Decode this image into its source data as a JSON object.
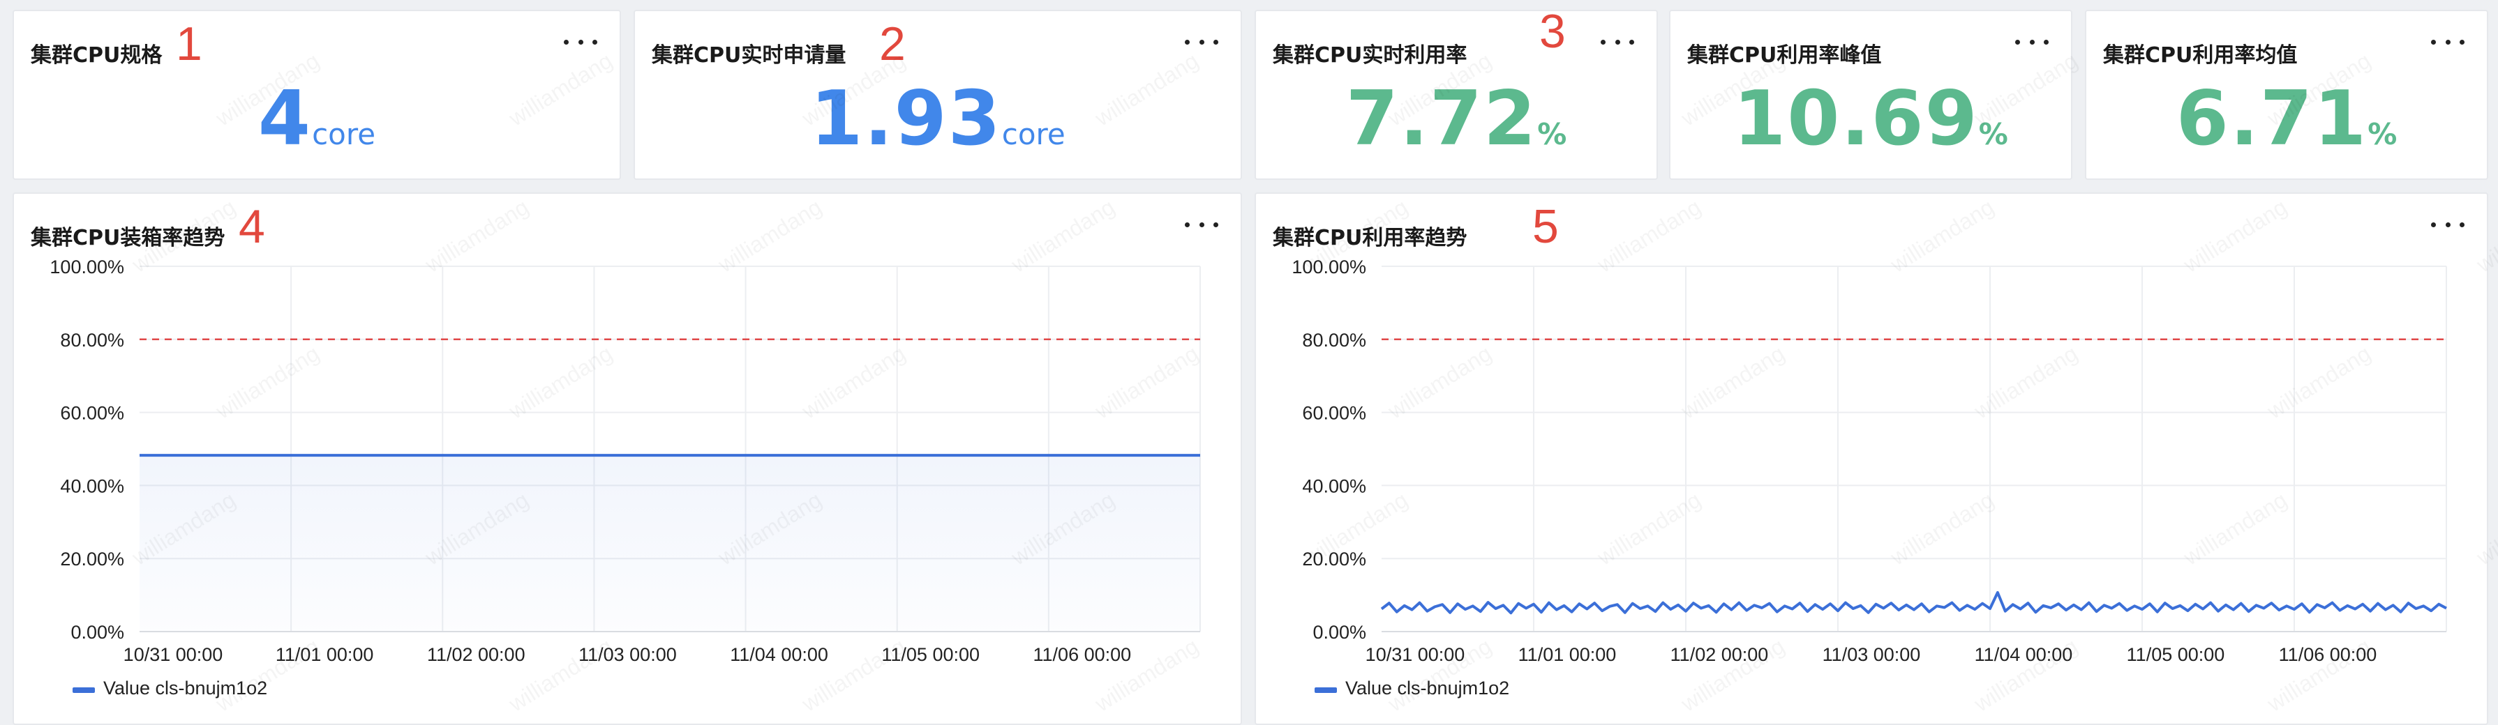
{
  "colors": {
    "blue_value": "#4187ea",
    "green_value": "#5cb98e",
    "marker_red": "#e2483d",
    "threshold_red": "#e04848",
    "series_blue": "#3b6fd8"
  },
  "cards": [
    {
      "title": "集群CPU规格",
      "value": "4",
      "unit": "core",
      "marker": "1"
    },
    {
      "title": "集群CPU实时申请量",
      "value": "1.93",
      "unit": "core",
      "marker": "2"
    },
    {
      "title": "集群CPU实时利用率",
      "value": "7.72",
      "unit": "%",
      "marker": "3"
    },
    {
      "title": "集群CPU利用率峰值",
      "value": "10.69",
      "unit": "%"
    },
    {
      "title": "集群CPU利用率均值",
      "value": "6.71",
      "unit": "%"
    }
  ],
  "more_icon": "more-horizontal-icon",
  "watermark": "williamdang",
  "chart_data": [
    {
      "type": "line",
      "title": "集群CPU装箱率趋势",
      "marker": "4",
      "y_ticks": [
        "100.00%",
        "80.00%",
        "60.00%",
        "40.00%",
        "20.00%",
        "0.00%"
      ],
      "ylim": [
        0,
        100
      ],
      "x_ticks": [
        "10/31 00:00",
        "11/01 00:00",
        "11/02 00:00",
        "11/03 00:00",
        "11/04 00:00",
        "11/05 00:00",
        "11/06 00:00"
      ],
      "threshold": 80,
      "legend": "Value cls-bnujm1o2",
      "series": [
        {
          "name": "Value cls-bnujm1o2",
          "x": [
            0,
            7
          ],
          "values": [
            48.25,
            48.25
          ]
        }
      ]
    },
    {
      "type": "line",
      "title": "集群CPU利用率趋势",
      "marker": "5",
      "y_ticks": [
        "100.00%",
        "80.00%",
        "60.00%",
        "40.00%",
        "20.00%",
        "0.00%"
      ],
      "ylim": [
        0,
        100
      ],
      "x_ticks": [
        "10/31 00:00",
        "11/01 00:00",
        "11/02 00:00",
        "11/03 00:00",
        "11/04 00:00",
        "11/05 00:00",
        "11/06 00:00"
      ],
      "threshold": 80,
      "legend": "Value cls-bnujm1o2",
      "series": [
        {
          "name": "Value cls-bnujm1o2",
          "x": [
            0.0,
            0.05,
            0.1,
            0.15,
            0.2,
            0.25,
            0.3,
            0.35,
            0.4,
            0.45,
            0.5,
            0.55,
            0.6,
            0.65,
            0.7,
            0.75,
            0.8,
            0.85,
            0.9,
            0.95,
            1.0,
            1.05,
            1.1,
            1.15,
            1.2,
            1.25,
            1.3,
            1.35,
            1.4,
            1.45,
            1.5,
            1.55,
            1.6,
            1.65,
            1.7,
            1.75,
            1.8,
            1.85,
            1.9,
            1.95,
            2.0,
            2.05,
            2.1,
            2.15,
            2.2,
            2.25,
            2.3,
            2.35,
            2.4,
            2.45,
            2.5,
            2.55,
            2.6,
            2.65,
            2.7,
            2.75,
            2.8,
            2.85,
            2.9,
            2.95,
            3.0,
            3.05,
            3.1,
            3.15,
            3.2,
            3.25,
            3.3,
            3.35,
            3.4,
            3.45,
            3.5,
            3.55,
            3.6,
            3.65,
            3.7,
            3.75,
            3.8,
            3.85,
            3.9,
            3.95,
            4.0,
            4.05,
            4.1,
            4.15,
            4.2,
            4.25,
            4.3,
            4.35,
            4.4,
            4.45,
            4.5,
            4.55,
            4.6,
            4.65,
            4.7,
            4.75,
            4.8,
            4.85,
            4.9,
            4.95,
            5.0,
            5.05,
            5.1,
            5.15,
            5.2,
            5.25,
            5.3,
            5.35,
            5.4,
            5.45,
            5.5,
            5.55,
            5.6,
            5.65,
            5.7,
            5.75,
            5.8,
            5.85,
            5.9,
            5.95,
            6.0,
            6.05,
            6.1,
            6.15,
            6.2,
            6.25,
            6.3,
            6.35,
            6.4,
            6.45,
            6.5,
            6.55,
            6.6,
            6.65,
            6.7,
            6.75,
            6.8,
            6.85,
            6.9,
            6.95,
            7.0
          ],
          "values": [
            6.2,
            7.8,
            5.4,
            7.1,
            6.0,
            7.9,
            5.6,
            6.8,
            7.4,
            5.2,
            7.6,
            6.1,
            7.0,
            5.5,
            8.0,
            6.3,
            7.2,
            5.1,
            7.7,
            6.4,
            7.5,
            5.3,
            7.9,
            6.0,
            7.1,
            5.4,
            7.6,
            6.2,
            7.8,
            5.7,
            6.9,
            7.4,
            5.2,
            7.7,
            6.3,
            7.0,
            5.5,
            7.9,
            6.1,
            7.3,
            5.6,
            7.8,
            6.4,
            7.1,
            5.3,
            7.6,
            6.0,
            7.9,
            5.8,
            7.2,
            6.5,
            7.7,
            5.4,
            7.0,
            6.2,
            7.8,
            5.5,
            7.4,
            6.1,
            7.6,
            5.7,
            7.9,
            6.3,
            7.1,
            5.2,
            7.5,
            6.4,
            7.8,
            5.9,
            7.3,
            6.0,
            7.6,
            5.4,
            7.0,
            6.6,
            7.9,
            5.8,
            7.2,
            6.1,
            7.7,
            6.3,
            10.69,
            5.6,
            7.4,
            6.2,
            7.8,
            5.3,
            7.1,
            6.5,
            7.6,
            5.9,
            7.3,
            6.0,
            7.9,
            5.5,
            7.2,
            6.4,
            7.7,
            5.8,
            7.0,
            6.1,
            7.6,
            5.4,
            7.8,
            6.3,
            7.1,
            5.7,
            7.5,
            6.2,
            7.9,
            5.6,
            7.3,
            6.0,
            7.7,
            5.5,
            7.2,
            6.4,
            7.8,
            5.9,
            7.0,
            6.1,
            7.6,
            5.3,
            7.4,
            6.5,
            7.9,
            5.8,
            7.1,
            6.2,
            7.5,
            5.6,
            7.7,
            6.0,
            7.2,
            5.4,
            7.8,
            6.3,
            7.0,
            5.7,
            7.5,
            6.4
          ]
        }
      ]
    }
  ]
}
